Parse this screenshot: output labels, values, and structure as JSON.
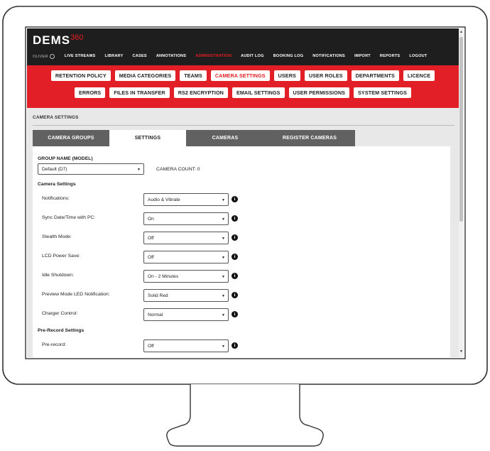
{
  "app": {
    "logo_main": "DEMS",
    "logo_sup": "360"
  },
  "nav": {
    "user": "OLIVER",
    "items": [
      {
        "label": "LIVE STREAMS",
        "active": false
      },
      {
        "label": "LIBRARY",
        "active": false
      },
      {
        "label": "CASES",
        "active": false
      },
      {
        "label": "ANNOTATIONS",
        "active": false
      },
      {
        "label": "ADMINISTRATION",
        "active": true
      },
      {
        "label": "AUDIT LOG",
        "active": false
      },
      {
        "label": "BOOKING LOG",
        "active": false
      },
      {
        "label": "NOTIFICATIONS",
        "active": false
      },
      {
        "label": "IMPORT",
        "active": false
      },
      {
        "label": "REPORTS",
        "active": false
      },
      {
        "label": "LOGOUT",
        "active": false
      }
    ]
  },
  "admin_buttons": {
    "row1": [
      "RETENTION POLICY",
      "MEDIA CATEGORIES",
      "TEAMS",
      "CAMERA SETTINGS",
      "USERS",
      "USER ROLES",
      "DEPARTMENTS",
      "LICENCE"
    ],
    "row2": [
      "ERRORS",
      "FILES IN TRANSFER",
      "RS2 ENCRYPTION",
      "EMAIL SETTINGS",
      "USER PERMISSIONS",
      "SYSTEM SETTINGS"
    ],
    "active": "CAMERA SETTINGS"
  },
  "section": {
    "title": "CAMERA SETTINGS"
  },
  "tabs": [
    {
      "label": "CAMERA GROUPS",
      "active": false
    },
    {
      "label": "SETTINGS",
      "active": true
    },
    {
      "label": "CAMERAS",
      "active": false
    },
    {
      "label": "REGISTER CAMERAS",
      "active": false
    }
  ],
  "form": {
    "group_label": "GROUP NAME (MODEL)",
    "group_value": "Default (D7)",
    "camera_count": "CAMERA COUNT: 0",
    "camera_settings_heading": "Camera Settings",
    "prerecord_heading": "Pre-Record Settings",
    "camera_rows": [
      {
        "label": "Notifications:",
        "value": "Audio & Vibrate"
      },
      {
        "label": "Sync Date/Time with PC:",
        "value": "On"
      },
      {
        "label": "Stealth Mode:",
        "value": "Off"
      },
      {
        "label": "LCD Power Save:",
        "value": "Off"
      },
      {
        "label": "Idle Shutdown:",
        "value": "On - 2 Minutes"
      },
      {
        "label": "Preview Mode LED Notification:",
        "value": "Solid Red"
      },
      {
        "label": "Charger Control:",
        "value": "Normal"
      }
    ],
    "prerecord_rows": [
      {
        "label": "Pre-record:",
        "value": "Off"
      }
    ]
  },
  "icons": {
    "info": "info-icon",
    "dropdown": "chevron-down-icon",
    "settings": "gear-icon"
  },
  "colors": {
    "accent": "#e21f26",
    "topbar": "#1e1e1e",
    "tab_inactive": "#616161"
  }
}
